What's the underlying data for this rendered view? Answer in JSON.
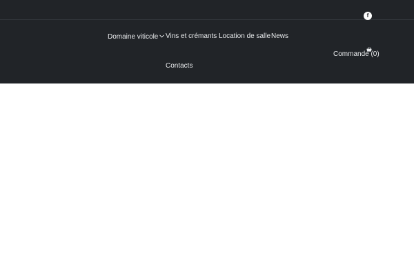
{
  "social": {
    "facebook_glyph": "f"
  },
  "nav": {
    "items": [
      {
        "label": "Domaine viticole",
        "has_dropdown": true
      },
      {
        "label": "Vins et crémants"
      },
      {
        "label": "Location de salle"
      },
      {
        "label": "News"
      },
      {
        "label": "Contacts"
      }
    ]
  },
  "cart": {
    "label": "Commande (0)"
  },
  "colors": {
    "header_bg": "#212428",
    "nav_text": "#e9ebed",
    "page_bg": "#ffffff"
  }
}
